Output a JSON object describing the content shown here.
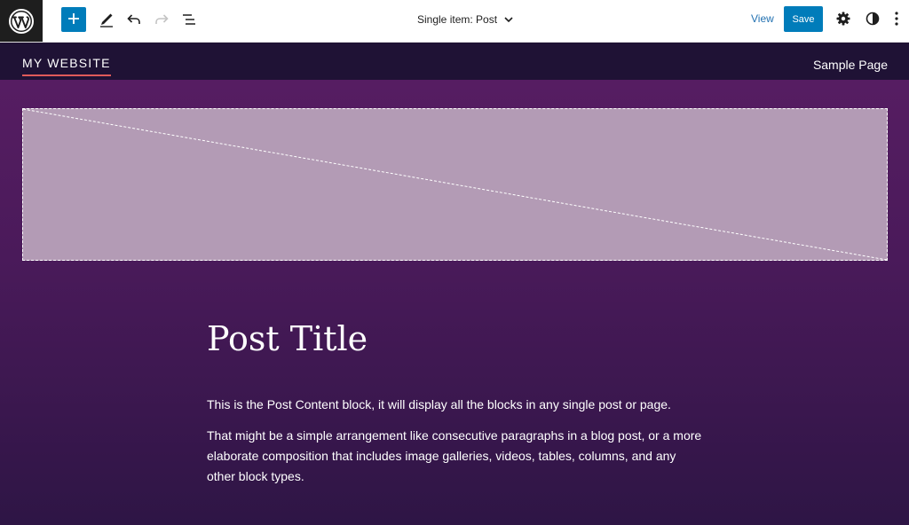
{
  "toolbar": {
    "logo_icon": "wordpress-logo-icon",
    "add_block_icon": "plus-icon",
    "tools_icon": "pencil-icon",
    "undo_icon": "undo-icon",
    "redo_icon": "redo-icon",
    "list_view_icon": "list-view-icon",
    "document_title": "Single item: Post",
    "document_title_icon": "chevron-down-icon",
    "view_label": "View",
    "save_label": "Save",
    "settings_icon": "gear-icon",
    "styles_icon": "half-circle-icon",
    "options_icon": "vertical-ellipsis-icon"
  },
  "site": {
    "title": "MY WEBSITE",
    "nav": [
      "Sample Page"
    ]
  },
  "post": {
    "featured_image_icon": "image-placeholder-icon",
    "title": "Post Title",
    "paragraphs": [
      "This is the Post Content block, it will display all the blocks in any single post or page.",
      "That might be a simple arrangement like consecutive paragraphs in a blog post, or a more elaborate composition that includes image galleries, videos, tables, columns, and any other block types."
    ]
  },
  "colors": {
    "toolbar_accent": "#007cba",
    "view_link": "#2271b1",
    "site_header_bg": "#1f1235",
    "content_bg_top": "#561d62",
    "content_bg_bottom": "#2e1545",
    "image_placeholder": "#b39bb5",
    "title_underline": "#e05a5a"
  }
}
